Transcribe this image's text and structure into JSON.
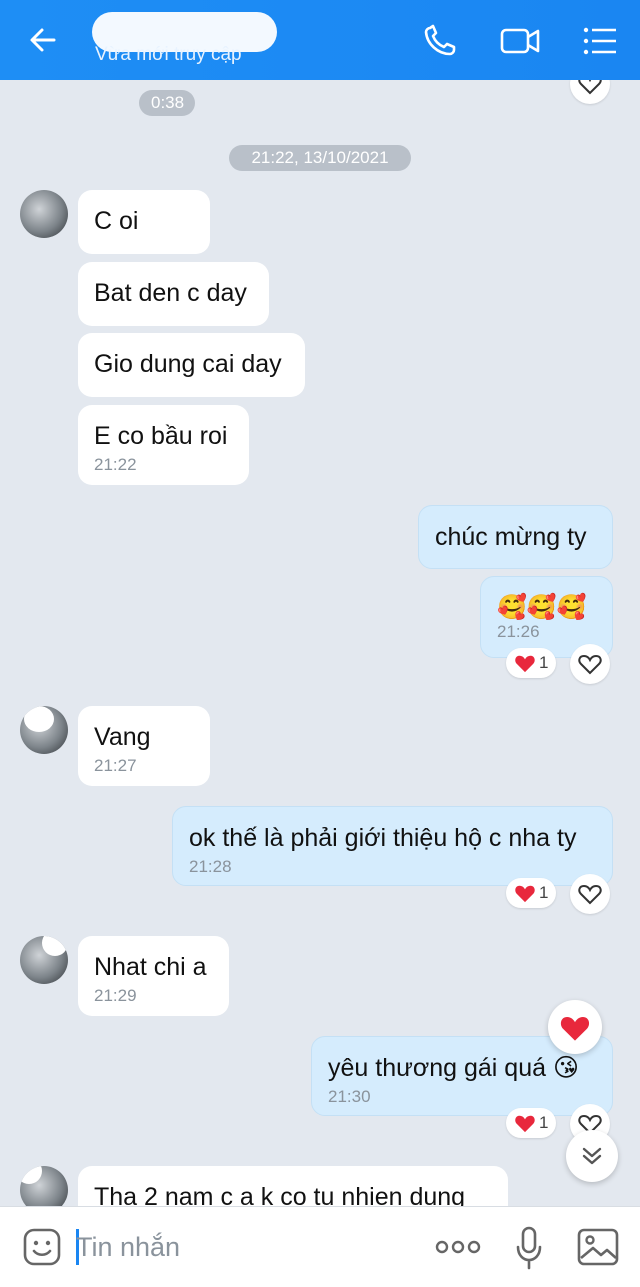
{
  "header": {
    "status": "Vừa mới truy cập",
    "icons": [
      "back-arrow-icon",
      "phone-icon",
      "video-icon",
      "menu-icon"
    ]
  },
  "messages_top": {
    "duration_chip": "0:38",
    "date_separator": "21:22, 13/10/2021"
  },
  "messages": [
    {
      "side": "in",
      "text": "C oi"
    },
    {
      "side": "in",
      "text": "Bat den c day"
    },
    {
      "side": "in",
      "text": "Gio dung cai day"
    },
    {
      "side": "in",
      "text": "E co bầu roi",
      "time": "21:22"
    },
    {
      "side": "out",
      "text": "chúc mừng ty"
    },
    {
      "side": "out",
      "text": "🥰🥰🥰",
      "time": "21:26",
      "reaction": {
        "emoji": "heart",
        "count": "1"
      }
    },
    {
      "side": "in",
      "text": "Vang",
      "time": "21:27"
    },
    {
      "side": "out",
      "text": "ok thế là phải giới thiệu hộ c nha ty",
      "time": "21:28",
      "reaction": {
        "emoji": "heart",
        "count": "1"
      }
    },
    {
      "side": "in",
      "text": "Nhat chi a",
      "time": "21:29"
    },
    {
      "side": "out",
      "text": "yêu thương gái quá 😘",
      "time": "21:30",
      "reaction": {
        "emoji": "heart",
        "count": "1"
      }
    },
    {
      "side": "in",
      "text": "Tha 2 nam c a k co tu nhien dung"
    }
  ],
  "composer": {
    "placeholder": "Tin nhắn",
    "icons": [
      "sticker-icon",
      "more-icon",
      "microphone-icon",
      "image-icon"
    ]
  },
  "colors": {
    "header": "#1a86f2",
    "background": "#e3e8ef",
    "incoming_bubble": "#ffffff",
    "outgoing_bubble": "#d5ecfd",
    "heart": "#e8283c"
  }
}
